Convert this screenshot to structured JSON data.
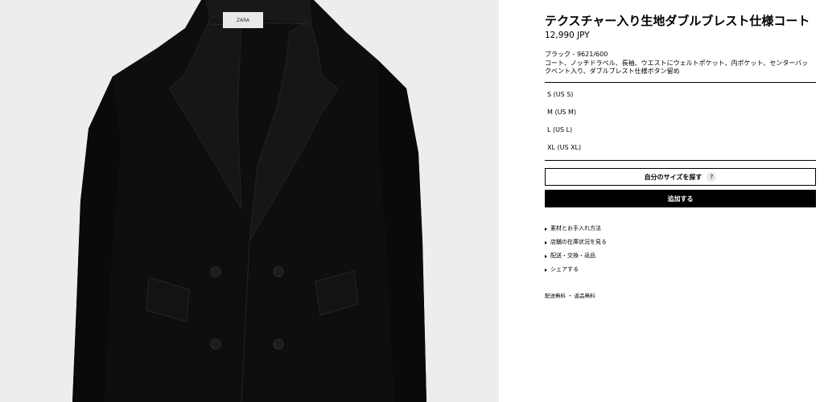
{
  "product": {
    "title": "テクスチャー入り生地ダブルブレスト仕様コート",
    "price": "12,990 JPY",
    "color_ref": "ブラック - 9621/600",
    "description": "コート、ノッチドラペル、長袖、ウエストにウェルトポケット、内ポケット、センターバックベント入り、ダブルブレスト仕様ボタン留め",
    "brand_label": "ZARA"
  },
  "sizes": [
    "S (US S)",
    "M (US M)",
    "L (US L)",
    "XL (US XL)"
  ],
  "actions": {
    "find_size_label": "自分のサイズを探す",
    "help_icon_glyph": "?",
    "add_label": "追加する"
  },
  "info_links": [
    "素材とお手入れ方法",
    "店舗の在庫状況を見る",
    "配送・交換・返品",
    "シェアする"
  ],
  "shipping_note": "配送無料 ・ 返品無料",
  "colors": {
    "background_image": "#ededed",
    "coat": "#0d0d0d",
    "accent_button": "#000000"
  }
}
